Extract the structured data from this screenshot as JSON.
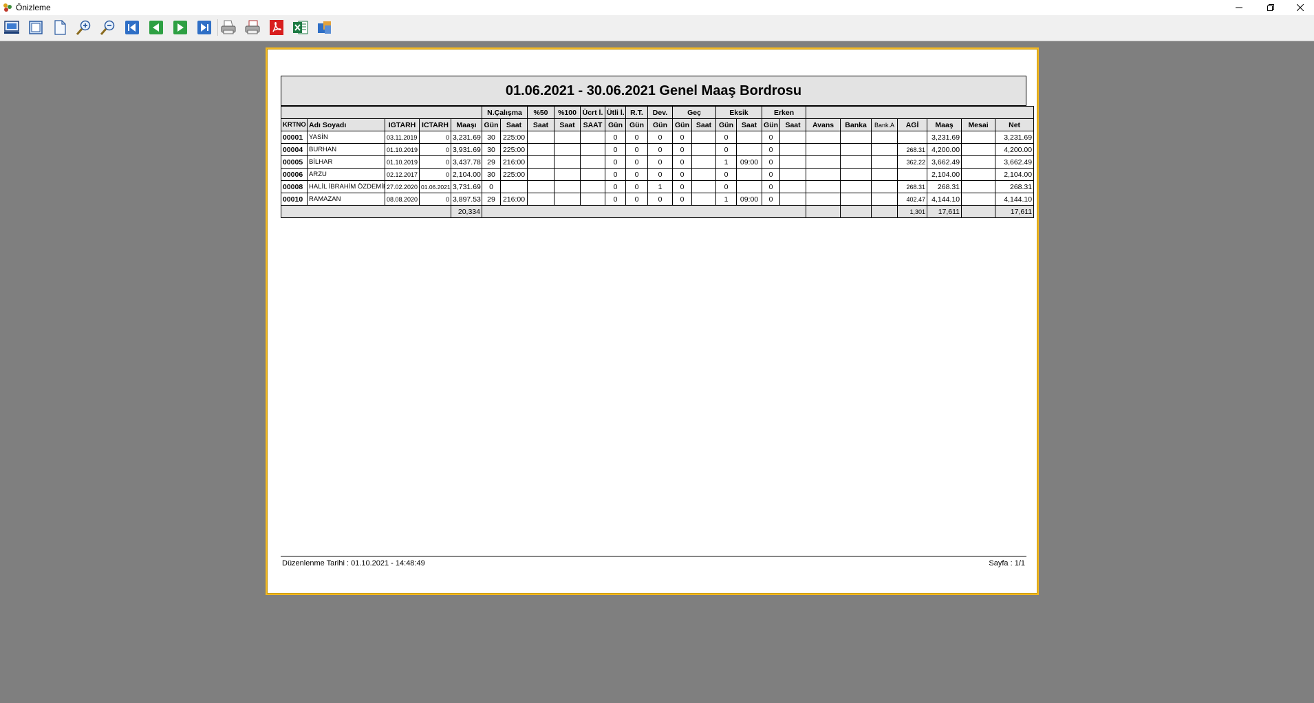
{
  "window": {
    "title": "Önizleme",
    "controls": [
      "minimize",
      "restore",
      "close"
    ]
  },
  "toolbar": {
    "buttons": [
      {
        "name": "print-preview-icon"
      },
      {
        "name": "page-view-icon"
      },
      {
        "name": "blank-page-icon"
      },
      {
        "name": "zoom-in-icon"
      },
      {
        "name": "zoom-out-icon"
      },
      {
        "name": "first-page-icon"
      },
      {
        "name": "previous-page-icon"
      },
      {
        "name": "next-page-icon"
      },
      {
        "name": "last-page-icon"
      },
      {
        "name": "printer-icon"
      },
      {
        "name": "print-setup-icon"
      },
      {
        "name": "export-pdf-icon"
      },
      {
        "name": "export-excel-icon"
      },
      {
        "name": "export-word-icon"
      }
    ]
  },
  "report": {
    "title": "01.06.2021 - 30.06.2021 Genel Maaş Bordrosu",
    "group_headers": {
      "n_calisma": "N.Çalışma",
      "p50": "%50",
      "p100": "%100",
      "ucret_izin": "Ücrt İ.",
      "utli_izin": "Ütli İ.",
      "rt": "R.T.",
      "dev": "Dev.",
      "gec": "Geç",
      "eksik": "Eksik",
      "erken": "Erken"
    },
    "columns": {
      "krtno": "KRTNO",
      "adi_soyadi": "Adı Soyadı",
      "igtarh": "IGTARH",
      "ictarh": "ICTARH",
      "maasi": "Maaşı",
      "gun": "Gün",
      "saat": "Saat",
      "saat_caps": "SAAT",
      "avans": "Avans",
      "banka": "Banka",
      "bank_a": "Bank.A",
      "agi": "AGİ",
      "maas": "Maaş",
      "mesai": "Mesai",
      "net": "Net"
    },
    "rows": [
      {
        "krtno": "00001",
        "name": "YASİN",
        "igtarh": "03.11.2019",
        "ictarh": "0",
        "maasi": "3,231.69",
        "nc_gun": "30",
        "nc_saat": "225:00",
        "p50": "",
        "p100": "",
        "ucret_saat": "",
        "utli_gun": "0",
        "rt_gun": "0",
        "dev_gun": "0",
        "gec_gun": "0",
        "gec_saat": "",
        "eksik_gun": "0",
        "eksik_saat": "",
        "erken_gun": "0",
        "erken_saat": "",
        "avans": "",
        "banka": "",
        "bank_a": "",
        "agi": "",
        "maas": "3,231.69",
        "mesai": "",
        "net": "3,231.69"
      },
      {
        "krtno": "00004",
        "name": "BURHAN",
        "igtarh": "01.10.2019",
        "ictarh": "0",
        "maasi": "3,931.69",
        "nc_gun": "30",
        "nc_saat": "225:00",
        "p50": "",
        "p100": "",
        "ucret_saat": "",
        "utli_gun": "0",
        "rt_gun": "0",
        "dev_gun": "0",
        "gec_gun": "0",
        "gec_saat": "",
        "eksik_gun": "0",
        "eksik_saat": "",
        "erken_gun": "0",
        "erken_saat": "",
        "avans": "",
        "banka": "",
        "bank_a": "",
        "agi": "268.31",
        "maas": "4,200.00",
        "mesai": "",
        "net": "4,200.00"
      },
      {
        "krtno": "00005",
        "name": "BİLHAR",
        "igtarh": "01.10.2019",
        "ictarh": "0",
        "maasi": "3,437.78",
        "nc_gun": "29",
        "nc_saat": "216:00",
        "p50": "",
        "p100": "",
        "ucret_saat": "",
        "utli_gun": "0",
        "rt_gun": "0",
        "dev_gun": "0",
        "gec_gun": "0",
        "gec_saat": "",
        "eksik_gun": "1",
        "eksik_saat": "09:00",
        "erken_gun": "0",
        "erken_saat": "",
        "avans": "",
        "banka": "",
        "bank_a": "",
        "agi": "362.22",
        "maas": "3,662.49",
        "mesai": "",
        "net": "3,662.49"
      },
      {
        "krtno": "00006",
        "name": "ARZU",
        "igtarh": "02.12.2017",
        "ictarh": "0",
        "maasi": "2,104.00",
        "nc_gun": "30",
        "nc_saat": "225:00",
        "p50": "",
        "p100": "",
        "ucret_saat": "",
        "utli_gun": "0",
        "rt_gun": "0",
        "dev_gun": "0",
        "gec_gun": "0",
        "gec_saat": "",
        "eksik_gun": "0",
        "eksik_saat": "",
        "erken_gun": "0",
        "erken_saat": "",
        "avans": "",
        "banka": "",
        "bank_a": "",
        "agi": "",
        "maas": "2,104.00",
        "mesai": "",
        "net": "2,104.00"
      },
      {
        "krtno": "00008",
        "name": "HALİL İBRAHİM ÖZDEMİR",
        "igtarh": "27.02.2020",
        "ictarh": "01.06.2021",
        "maasi": "3,731.69",
        "nc_gun": "0",
        "nc_saat": "",
        "p50": "",
        "p100": "",
        "ucret_saat": "",
        "utli_gun": "0",
        "rt_gun": "0",
        "dev_gun": "1",
        "gec_gun": "0",
        "gec_saat": "",
        "eksik_gun": "0",
        "eksik_saat": "",
        "erken_gun": "0",
        "erken_saat": "",
        "avans": "",
        "banka": "",
        "bank_a": "",
        "agi": "268.31",
        "maas": "268.31",
        "mesai": "",
        "net": "268.31"
      },
      {
        "krtno": "00010",
        "name": "RAMAZAN",
        "igtarh": "08.08.2020",
        "ictarh": "0",
        "maasi": "3,897.53",
        "nc_gun": "29",
        "nc_saat": "216:00",
        "p50": "",
        "p100": "",
        "ucret_saat": "",
        "utli_gun": "0",
        "rt_gun": "0",
        "dev_gun": "0",
        "gec_gun": "0",
        "gec_saat": "",
        "eksik_gun": "1",
        "eksik_saat": "09:00",
        "erken_gun": "0",
        "erken_saat": "",
        "avans": "",
        "banka": "",
        "bank_a": "",
        "agi": "402.47",
        "maas": "4,144.10",
        "mesai": "",
        "net": "4,144.10"
      }
    ],
    "totals": {
      "maasi": "20,334",
      "agi": "1,301",
      "maas": "17,611",
      "net": "17,611"
    },
    "footer": {
      "left": "Düzenlenme Tarihi : 01.10.2021 - 14:48:49",
      "right": "Sayfa : 1/1"
    }
  },
  "colors": {
    "canvas": "#7f7f7f",
    "page_border": "#f3b820",
    "header_fill": "#e3e3e3",
    "pdf_red": "#d81e1e",
    "excel_green": "#1d7a43",
    "nav_blue": "#2f6fc6",
    "nav_green": "#2ea043"
  }
}
